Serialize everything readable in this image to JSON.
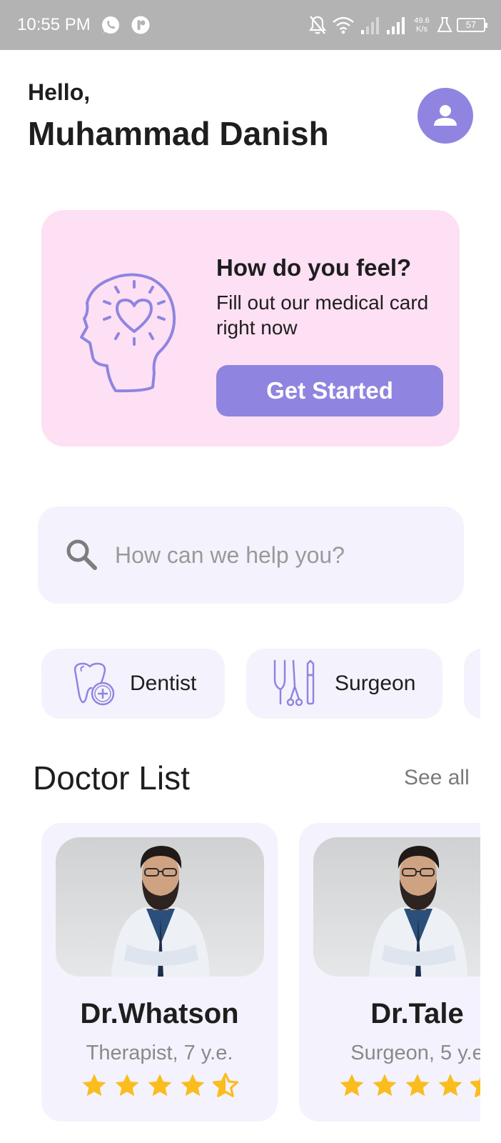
{
  "status_bar": {
    "time": "10:55 PM",
    "net_speed_value": "49.6",
    "net_speed_unit": "K/s",
    "battery": "57",
    "icons": [
      "whatsapp-icon",
      "app-notification-icon",
      "bell-off-icon",
      "wifi-icon",
      "signal-icon",
      "signal-icon",
      "flask-icon",
      "battery-icon"
    ]
  },
  "header": {
    "greeting": "Hello,",
    "name": "Muhammad Danish"
  },
  "promo": {
    "title": "How do you feel?",
    "text": "Fill out our medical card right now",
    "button": "Get Started",
    "illustration": "head-heart-icon"
  },
  "search": {
    "placeholder": "How can we help you?",
    "value": ""
  },
  "categories": [
    {
      "label": "Dentist",
      "icon": "tooth-icon"
    },
    {
      "label": "Surgeon",
      "icon": "surgical-tools-icon"
    },
    {
      "label": "",
      "icon": ""
    }
  ],
  "doctor_section": {
    "title": "Doctor List",
    "see_all": "See all"
  },
  "doctors": [
    {
      "name": "Dr.Whatson",
      "specialty": "Therapist, 7 y.e.",
      "rating": 4.5
    },
    {
      "name": "Dr.Tale",
      "specialty": "Surgeon, 5 y.e",
      "rating": 4.5
    }
  ],
  "colors": {
    "accent": "#8f85e0",
    "promo_bg": "#fde0f3",
    "card_bg": "#f4f2fc",
    "star": "#fbbd1e",
    "status_bar": "#b3b3b3"
  }
}
